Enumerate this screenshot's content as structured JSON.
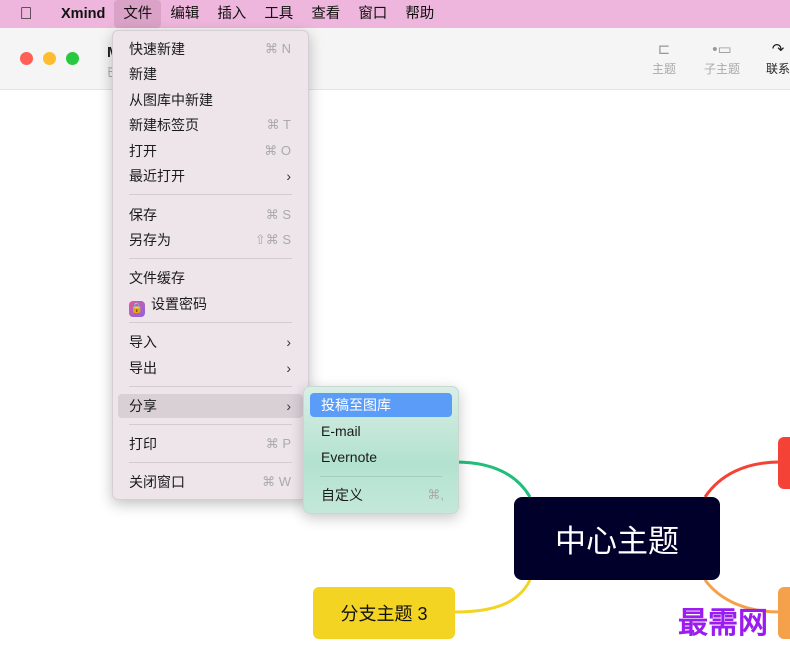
{
  "menubar": {
    "apple": "",
    "app": "Xmind",
    "items": [
      "文件",
      "编辑",
      "插入",
      "工具",
      "查看",
      "窗口",
      "帮助"
    ]
  },
  "window": {
    "title": "M",
    "subtitle": "已"
  },
  "toolbar": {
    "topic": "主题",
    "subtopic": "子主题",
    "relation": "联系"
  },
  "file_menu": {
    "quick_new": "快速新建",
    "quick_new_sc": "⌘ N",
    "new": "新建",
    "new_from_gallery": "从图库中新建",
    "new_tab": "新建标签页",
    "new_tab_sc": "⌘ T",
    "open": "打开",
    "open_sc": "⌘ O",
    "recent": "最近打开",
    "save": "保存",
    "save_sc": "⌘ S",
    "save_as": "另存为",
    "save_as_sc": "⇧⌘ S",
    "file_cache": "文件缓存",
    "set_password": "设置密码",
    "import": "导入",
    "export": "导出",
    "share": "分享",
    "print": "打印",
    "print_sc": "⌘ P",
    "close": "关闭窗口",
    "close_sc": "⌘ W",
    "arrow": "›"
  },
  "share_menu": {
    "gallery": "投稿至图库",
    "email": "E-mail",
    "evernote": "Evernote",
    "custom": "自定义",
    "custom_sc": "⌘,"
  },
  "map": {
    "center": "中心主题",
    "branch3": "分支主题 3"
  },
  "watermark": "最需网"
}
